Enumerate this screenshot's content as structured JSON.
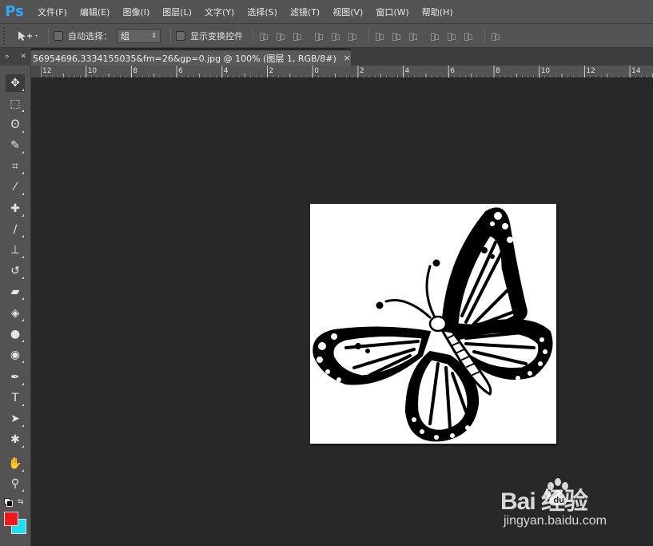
{
  "app": {
    "logo": "Ps"
  },
  "menu": {
    "items": [
      "文件(F)",
      "编辑(E)",
      "图像(I)",
      "图层(L)",
      "文字(Y)",
      "选择(S)",
      "滤镜(T)",
      "视图(V)",
      "窗口(W)",
      "帮助(H)"
    ]
  },
  "options": {
    "auto_select_label": "自动选择：",
    "auto_select_checked": false,
    "auto_select_target": "组",
    "show_transform_label": "显示变换控件",
    "show_transform_checked": false
  },
  "document_tab": {
    "title": "56954696,3334155035&fm=26&gp=0.jpg @ 100% (图层 1, RGB/8#) *",
    "close_glyph": "×"
  },
  "ruler": {
    "ticks": [
      "12",
      "10",
      "8",
      "6",
      "4",
      "2",
      "0",
      "2",
      "4",
      "6",
      "8",
      "10",
      "12",
      "14"
    ]
  },
  "tools": [
    {
      "name": "move",
      "glyph": "✥"
    },
    {
      "name": "marquee",
      "glyph": "⬚"
    },
    {
      "name": "lasso",
      "glyph": "ʘ"
    },
    {
      "name": "quick-select",
      "glyph": "✎"
    },
    {
      "name": "crop",
      "glyph": "⌗"
    },
    {
      "name": "eyedropper",
      "glyph": "⁄"
    },
    {
      "name": "healing",
      "glyph": "✚"
    },
    {
      "name": "brush",
      "glyph": "∕"
    },
    {
      "name": "clone-stamp",
      "glyph": "⊥"
    },
    {
      "name": "history-brush",
      "glyph": "↺"
    },
    {
      "name": "eraser",
      "glyph": "▰"
    },
    {
      "name": "paint-bucket",
      "glyph": "◈"
    },
    {
      "name": "blur",
      "glyph": "●"
    },
    {
      "name": "dodge",
      "glyph": "◉"
    },
    {
      "name": "pen",
      "glyph": "✒"
    },
    {
      "name": "type",
      "glyph": "T"
    },
    {
      "name": "path-select",
      "glyph": "➤"
    },
    {
      "name": "shape",
      "glyph": "✱"
    },
    {
      "name": "hand",
      "glyph": "✋"
    },
    {
      "name": "zoom",
      "glyph": "⚲"
    }
  ],
  "colors": {
    "foreground": "#f01818",
    "background": "#18e0ee",
    "menubar_bg": "#535353",
    "canvas_bg": "#282828"
  },
  "watermark": {
    "main": "Bai  经验",
    "sub": "jingyan.baidu.com"
  }
}
